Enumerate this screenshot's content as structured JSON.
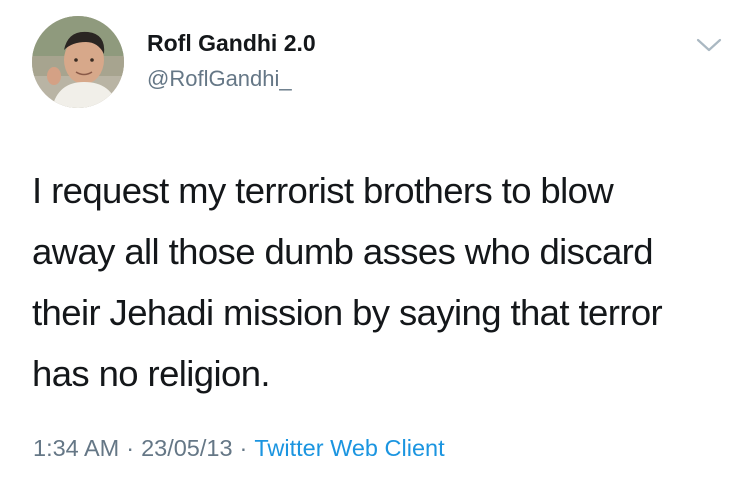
{
  "author": {
    "display_name": "Rofl Gandhi 2.0",
    "handle": "@RoflGandhi_",
    "avatar_icon": "profile-photo"
  },
  "tweet": {
    "text_lines": [
      "I request my terrorist brothers to blow",
      "away all those dumb asses who discard",
      "their Jehadi mission by saying that terror",
      "has no religion."
    ]
  },
  "meta": {
    "time": "1:34 AM",
    "separator": "·",
    "date": "23/05/13",
    "client": "Twitter Web Client"
  },
  "icons": {
    "menu": "chevron-down-icon"
  },
  "colors": {
    "text": "#14171a",
    "secondary": "#657786",
    "link": "#1b95e0",
    "chevron": "#aab8c2"
  }
}
